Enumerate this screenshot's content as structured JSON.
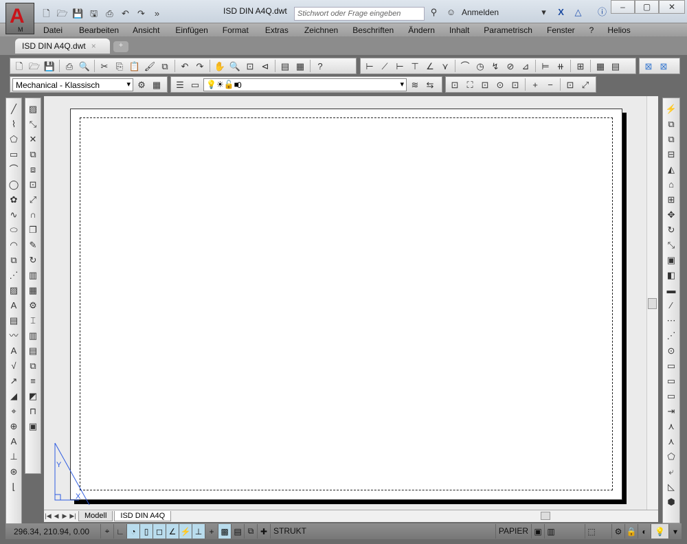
{
  "title_bar": {
    "app_button_label": "M",
    "document_title": "ISD DIN A4Q.dwt",
    "search_placeholder": "Stichwort oder Frage eingeben",
    "sign_in": "Anmelden",
    "quick_access_icons": [
      "new-icon",
      "open-icon",
      "save-icon",
      "save-as-icon",
      "print-icon",
      "undo-icon",
      "redo-icon",
      "more-icon"
    ]
  },
  "menu": [
    "Datei",
    "Bearbeiten",
    "Ansicht",
    "Einfügen",
    "Format",
    "Extras",
    "Zeichnen",
    "Beschriften",
    "Ändern",
    "Inhalt",
    "Parametrisch",
    "Fenster",
    "?",
    "Helios"
  ],
  "document_tab": {
    "label": "ISD DIN A4Q.dwt"
  },
  "toolbars": {
    "workspace": "Mechanical - Klassisch",
    "layer": "0",
    "standard_icons": [
      "new-icon",
      "open-icon",
      "save-icon",
      "|",
      "print-icon",
      "preview-icon",
      "|",
      "cut-icon",
      "copy-icon",
      "paste-icon",
      "match-icon",
      "block-icon",
      "|",
      "undo-icon",
      "redo-icon",
      "|",
      "pan-icon",
      "zoom-realtime-icon",
      "zoom-window-icon",
      "zoom-previous-icon",
      "|",
      "properties-icon",
      "calculator-icon",
      "|",
      "help-icon"
    ],
    "dimension_icons": [
      "dim-linear-icon",
      "dim-aligned-icon",
      "dim-horizontal-icon",
      "dim-vertical-icon",
      "dim-angle-icon",
      "dim-ordinate-icon",
      "|",
      "dim-arc-icon",
      "dim-radius-icon",
      "dim-jogged-icon",
      "dim-diameter-icon",
      "dim-angular-icon",
      "|",
      "dim-baseline-icon",
      "dim-continue-icon",
      "|",
      "tolerance-icon",
      "|",
      "grid-icon",
      "table-icon"
    ],
    "zoom_icons": [
      "zoom-window-icon",
      "zoom-dynamic-icon",
      "zoom-scale-icon",
      "zoom-center-icon",
      "zoom-object-icon",
      "|",
      "zoom-in-icon",
      "zoom-out-icon",
      "|",
      "zoom-all-icon",
      "zoom-extents-icon"
    ]
  },
  "layout_tabs": [
    "Modell",
    "ISD DIN A4Q"
  ],
  "status_bar": {
    "coordinates": "296.34, 210.94, 0.00",
    "strukt": "STRUKT",
    "papier": "PAPIER"
  }
}
